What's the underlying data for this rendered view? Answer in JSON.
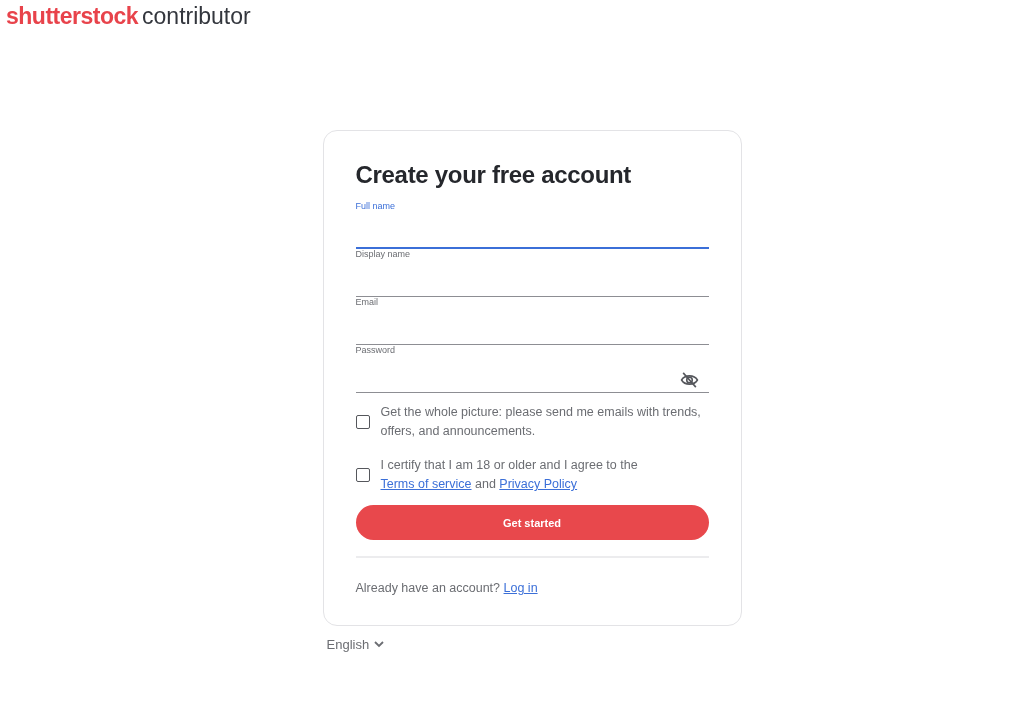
{
  "header": {
    "logo_brand": "shutterstock",
    "logo_product": "contributor"
  },
  "form": {
    "title": "Create your free account",
    "fields": [
      {
        "label": "Full name",
        "kind": "text",
        "focused": true
      },
      {
        "label": "Display name",
        "kind": "text",
        "focused": false
      },
      {
        "label": "Email",
        "kind": "text",
        "focused": false
      },
      {
        "label": "Password",
        "kind": "password",
        "focused": false
      }
    ],
    "checkboxes": [
      {
        "checked": false,
        "parts": [
          {
            "kind": "text",
            "text": "Get the whole picture: please send me emails with trends, offers, and announcements."
          }
        ]
      },
      {
        "checked": false,
        "parts": [
          {
            "kind": "text",
            "text": "I certify that I am 18 or older and I agree to the "
          },
          {
            "kind": "link",
            "text": "Terms of service"
          },
          {
            "kind": "text",
            "text": " and "
          },
          {
            "kind": "link",
            "text": "Privacy Policy"
          }
        ]
      }
    ],
    "submit": "Get started",
    "login_prompt": "Already have an account? ",
    "login_link": "Log in"
  },
  "language": "English"
}
